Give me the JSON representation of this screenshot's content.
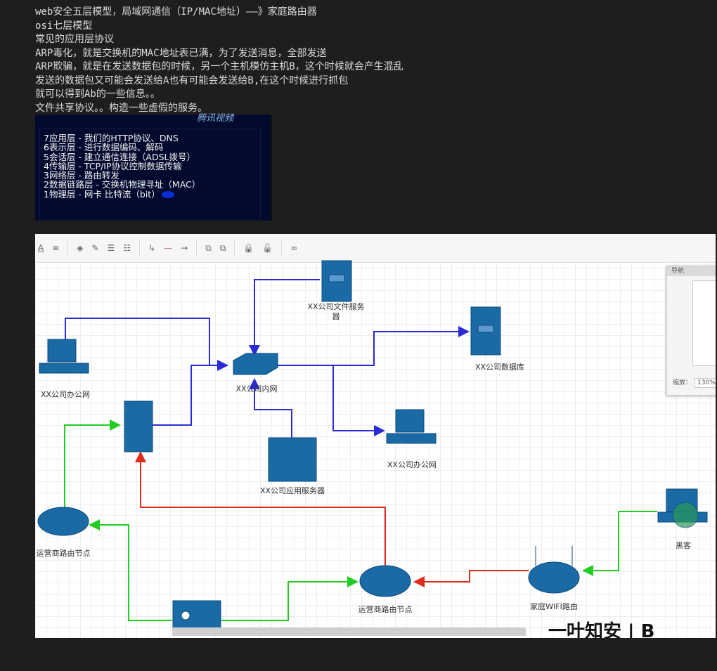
{
  "notes": [
    "web安全五层模型，局域网通信（IP/MAC地址）——》家庭路由器",
    "osi七层模型",
    "常见的应用层协议",
    "ARP毒化，就是交换机的MAC地址表已满，为了发送消息，全部发送",
    "ARP欺骗，就是在发送数据包的时候，另一个主机模仿主机B，这个时候就会产生混乱",
    "发送的数据包又可能会发送给A也有可能会发送给B,在这个时候进行抓包",
    "就可以得到Ab的一些信息。。",
    "文件共享协议。。构造一些虚假的服务。"
  ],
  "osi_image": {
    "logo": "腾讯视频",
    "layers": [
      "7应用层 - 我们的HTTP协议、DNS",
      "6表示层 - 进行数据编码、解码",
      "5会话层 - 建立通信连接（ADSL拨号）",
      "4传输层 - TCP/IP协议控制数据传输",
      "3网络层 - 路由转发",
      "2数据链路层 - 交换机物理寻址（MAC）",
      "1物理层 - 网卡 比特流（bit）"
    ]
  },
  "diagram": {
    "toolbar": [
      "A",
      "≡",
      "◈",
      "✎",
      "☰",
      "☷",
      "↳",
      "—",
      "→",
      "⧉",
      "⧉",
      "🔒",
      "🔓",
      "∞"
    ],
    "nodes": {
      "file_server": [
        "XX公司文件服务",
        "器"
      ],
      "database": "XX公司数据库",
      "office_left": "XX公司办公网",
      "switch": "XX公司内网",
      "office_right": "XX公司办公网",
      "app_server": "XX公司应用服务器",
      "isp_left": "运营商路由节点",
      "isp_center": "运营商路由节点",
      "home_router": "家庭WIFI路由",
      "hacker": "黑客"
    },
    "navigator": {
      "title": "导航",
      "zoom_label": "缩放：",
      "zoom_value": "130%"
    },
    "brand": "一叶知安 | B",
    "colors": {
      "device": "#1a6aa6",
      "blue_link": "#2b2bd6",
      "green_link": "#22cc22",
      "red_link": "#e02a1a"
    }
  }
}
